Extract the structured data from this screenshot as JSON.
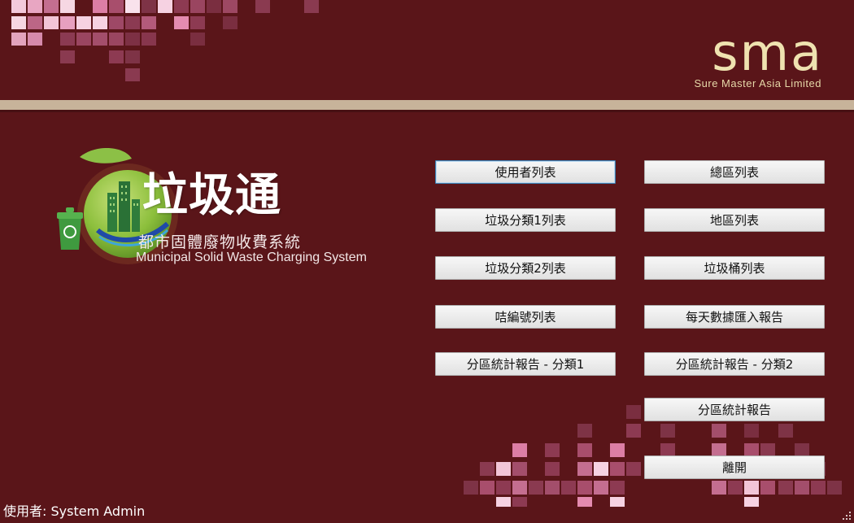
{
  "brand": {
    "mark": "sma",
    "company": "Sure Master Asia Limited"
  },
  "logo": {
    "title": "垃圾通",
    "subtitle_zh": "都市固體廢物收費系統",
    "subtitle_en": "Municipal Solid Waste Charging System",
    "icon": "recycle-bin-city-icon"
  },
  "menu": {
    "left": [
      "使用者列表",
      "垃圾分類1列表",
      "垃圾分類2列表",
      "咭編號列表",
      "分區統計報告 - 分類1"
    ],
    "right": [
      "總區列表",
      "地區列表",
      "垃圾桶列表",
      "每天數據匯入報告",
      "分區統計報告 - 分類2",
      "分區統計報告"
    ],
    "exit": "離開"
  },
  "status": {
    "user_label": "使用者:",
    "user_name": "System Admin"
  },
  "colors": {
    "background": "#5a1519",
    "divider": "#c7b39a",
    "brand_text": "#efe2b0",
    "tile_pink": "#e48bb0",
    "tile_light": "#f6d2e2"
  }
}
